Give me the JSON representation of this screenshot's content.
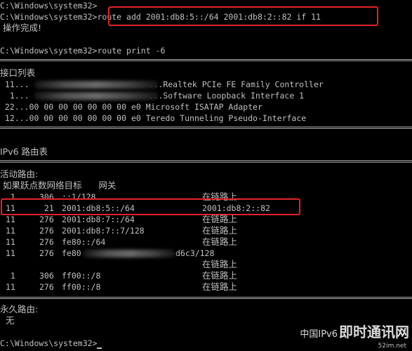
{
  "console": {
    "prompt": "C:\\Windows\\system32>",
    "cmd_add": "route add 2001:db8:5::/64 2001:db8:2::82 if 11",
    "ok": "操作完成!",
    "cmd_print": "route print -6",
    "iface_header": "接口列表",
    "interfaces": [
      {
        "id": " 11...",
        "tail": "...Realtek PCIe FE Family Controller"
      },
      {
        "id": "  1...",
        "tail": "...Software Loopback Interface 1"
      },
      {
        "id": " 22...",
        "tail": "00 00 00 00 00 00 00 e0 Microsoft ISATAP Adapter"
      },
      {
        "id": " 12...",
        "tail": "00 00 00 00 00 00 00 e0 Teredo Tunneling Pseudo-Interface"
      }
    ],
    "ipv6_table": "IPv6 路由表",
    "active_routes": "活动路由:",
    "col_header": " 如果跃点数网络目标      网关",
    "routes": [
      {
        "iface": " 1",
        "metric": "306",
        "dest": "::1/128",
        "gw": "在链路上"
      },
      {
        "iface": "11",
        "metric": " 21",
        "dest": "2001:db8:5::/64",
        "gw": "2001:db8:2::82"
      },
      {
        "iface": "11",
        "metric": "276",
        "dest": "2001:db8:7::/64",
        "gw": "在链路上"
      },
      {
        "iface": "11",
        "metric": "276",
        "dest": "2001:db8:7::7/128",
        "gw": "在链路上"
      },
      {
        "iface": "11",
        "metric": "276",
        "dest": "fe80::/64",
        "gw": "在链路上"
      },
      {
        "iface": "11",
        "metric": "276",
        "dest": "fe80",
        "dest_tail": "d6c3/128",
        "gw": "在链路上"
      },
      {
        "iface": " 1",
        "metric": "306",
        "dest": "ff00::/8",
        "gw": "在链路上"
      },
      {
        "iface": "11",
        "metric": "276",
        "dest": "ff00::/8",
        "gw": "在链路上"
      }
    ],
    "persistent_routes": "永久路由:",
    "none": "  无"
  },
  "watermark": {
    "text_cn": "中国IPv6",
    "brand": "即时通讯网",
    "url": "52im.net"
  },
  "colors": {
    "background": "#000000",
    "text": "#c0c0c0",
    "highlight": "#e3232c"
  }
}
